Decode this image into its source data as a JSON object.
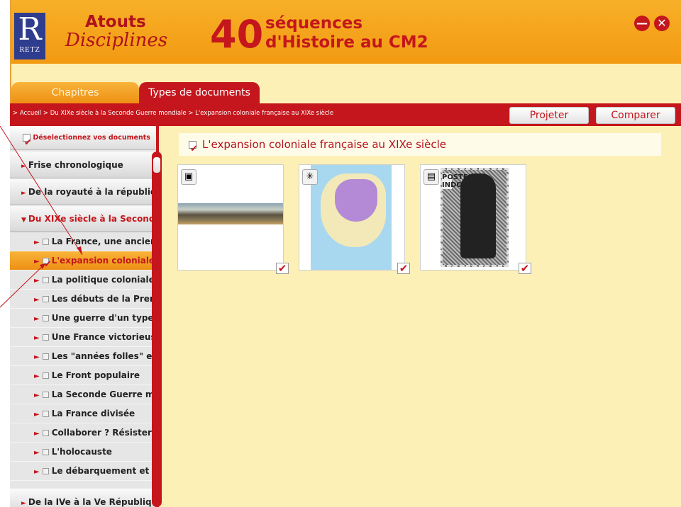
{
  "app": {
    "logo_letter": "R",
    "logo_text": "RETZ",
    "brand_line1": "Atouts",
    "brand_line2": "Disciplines",
    "title_number": "40",
    "title_line1": "séquences",
    "title_line2": "d'Histoire au CM2",
    "minimize_symbol": "—",
    "close_symbol": "✕"
  },
  "tabs": [
    {
      "label": "Chapitres",
      "active": false
    },
    {
      "label": "Types de documents",
      "active": true
    }
  ],
  "breadcrumb": "> Accueil  >  Du XIXe siècle à la Seconde Guerre mondiale  >  L'expansion coloniale française au XIXe siècle",
  "toolbar": {
    "projeter": "Projeter",
    "comparer": "Comparer"
  },
  "sidebar": {
    "deselect_label": "Déselectionnez vos documents",
    "sections": [
      {
        "label": "Frise chronologique",
        "arrow": "►"
      },
      {
        "label": "De la royauté à la républiq",
        "arrow": "►"
      },
      {
        "label": "Du XIXe siècle à la Second",
        "arrow": "▼"
      }
    ],
    "items": [
      {
        "label": "La France, une ancien"
      },
      {
        "label": "L'expansion coloniale"
      },
      {
        "label": "La politique coloniale"
      },
      {
        "label": "Les débuts de la Prem"
      },
      {
        "label": "Une guerre d'un type"
      },
      {
        "label": "Une France victorieus"
      },
      {
        "label": "Les \"années folles\" et"
      },
      {
        "label": "Le Front populaire"
      },
      {
        "label": "La Seconde Guerre m"
      },
      {
        "label": "La France divisée"
      },
      {
        "label": "Collaborer ? Résister"
      },
      {
        "label": "L'holocauste"
      },
      {
        "label": "Le débarquement et l"
      }
    ],
    "last_section": {
      "label": "De la IVe à la Ve Républiqu",
      "arrow": "►"
    }
  },
  "content": {
    "section_title": "L'expansion coloniale française au XIXe siècle",
    "cards": [
      {
        "badge_icon": "▣",
        "type": "painting"
      },
      {
        "badge_icon": "✳",
        "type": "map"
      },
      {
        "badge_icon": "▤",
        "type": "stamp",
        "stamp_text": "POSTES INDOCHINE"
      }
    ]
  },
  "colors": {
    "accent_red": "#c4161c",
    "orange": "#f29a12",
    "cream": "#fdf0b6"
  }
}
